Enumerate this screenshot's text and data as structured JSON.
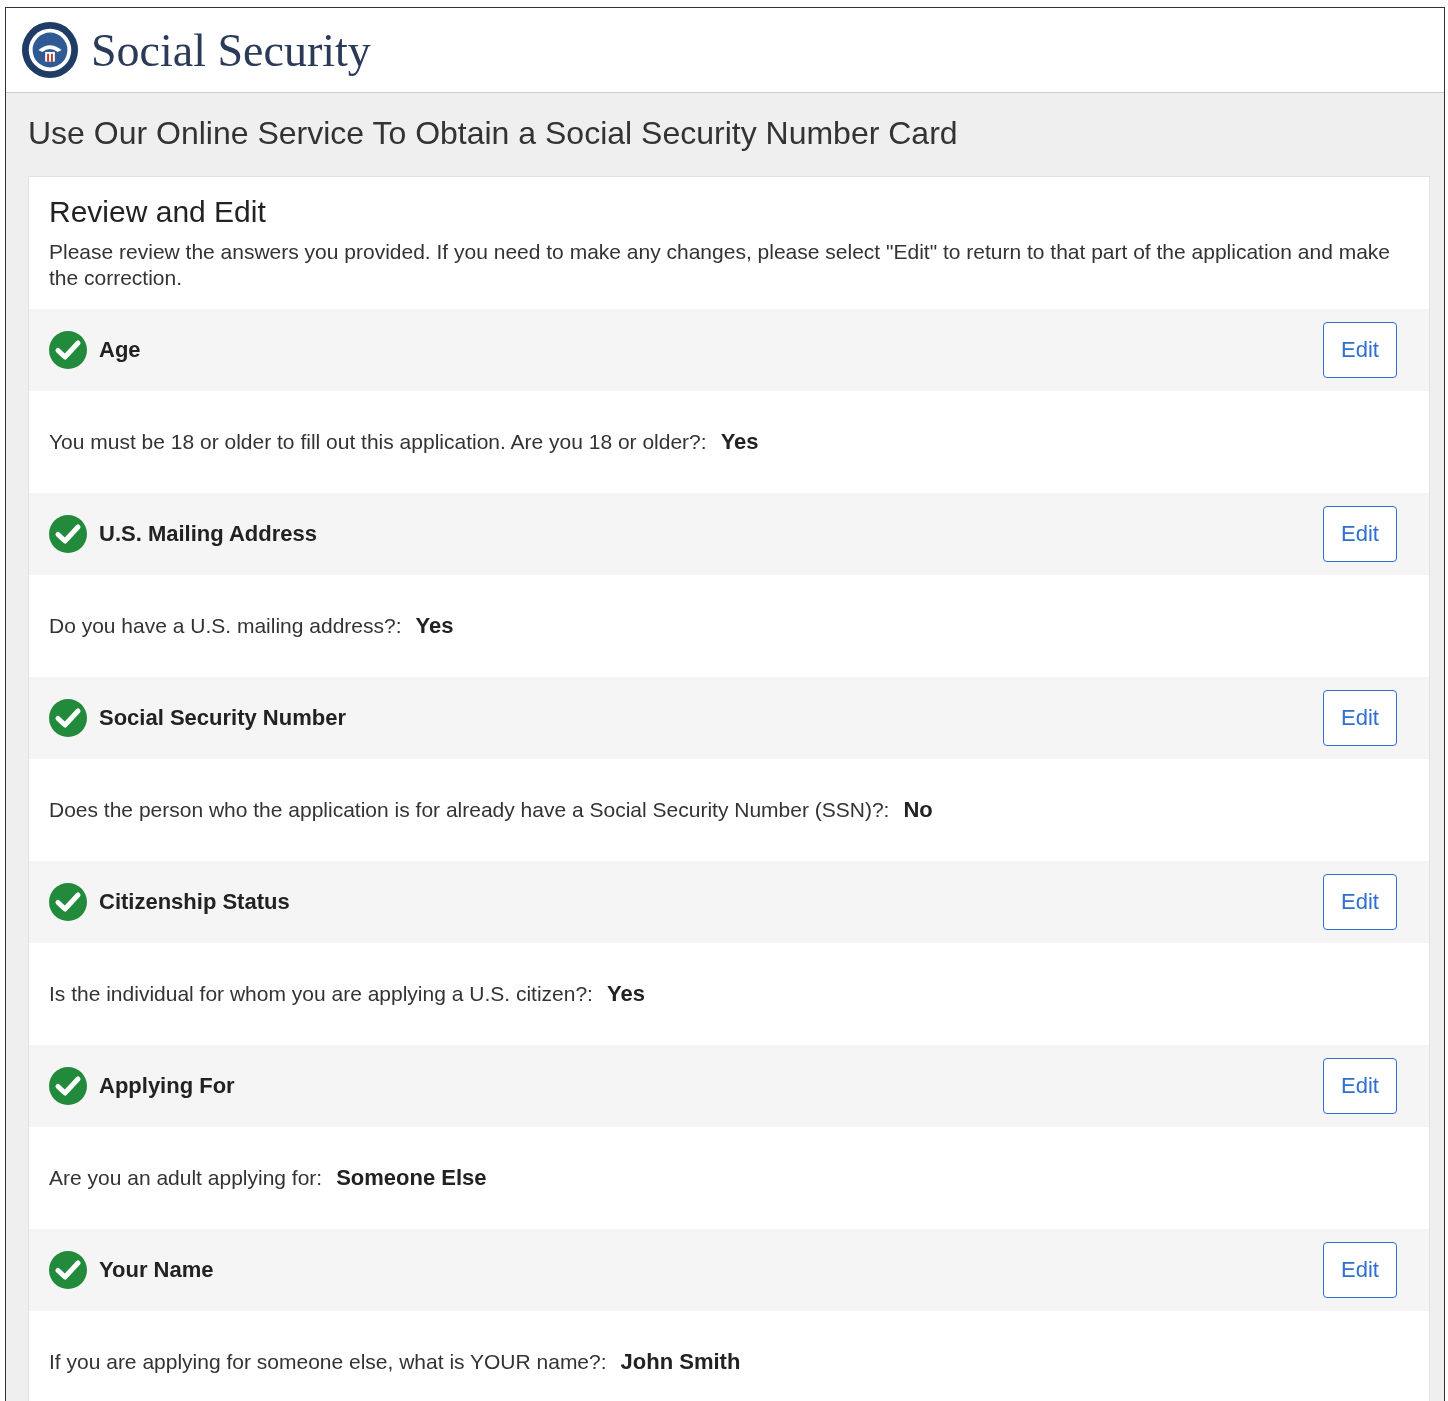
{
  "header": {
    "site_name": "Social Security"
  },
  "page_title": "Use Our Online Service To Obtain a Social Security Number Card",
  "review": {
    "heading": "Review and Edit",
    "intro": "Please review the answers you provided. If you need to make any changes, please select \"Edit\" to return to that part of the application and make the correction."
  },
  "sections": [
    {
      "title": "Age",
      "complete": true,
      "edit_label": "Edit",
      "question": "You must be 18 or older to fill out this application. Are you 18 or older?:",
      "answer": "Yes"
    },
    {
      "title": "U.S. Mailing Address",
      "complete": true,
      "edit_label": "Edit",
      "question": "Do you have a U.S. mailing address?:",
      "answer": "Yes"
    },
    {
      "title": "Social Security Number",
      "complete": true,
      "edit_label": "Edit",
      "question": "Does the person who the application is for already have a Social Security Number (SSN)?:",
      "answer": "No"
    },
    {
      "title": "Citizenship Status",
      "complete": true,
      "edit_label": "Edit",
      "question": "Is the individual for whom you are applying a U.S. citizen?:",
      "answer": "Yes"
    },
    {
      "title": "Applying For",
      "complete": true,
      "edit_label": "Edit",
      "question": "Are you an adult applying for:",
      "answer": "Someone Else"
    },
    {
      "title": "Your Name",
      "complete": true,
      "edit_label": "Edit",
      "question": "If you are applying for someone else, what is YOUR name?:",
      "answer": "John Smith"
    }
  ]
}
